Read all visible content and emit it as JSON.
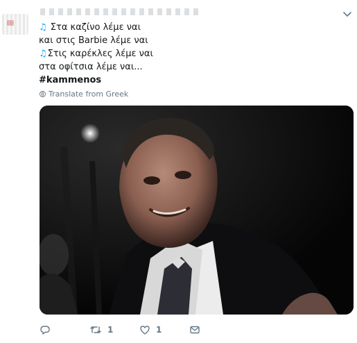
{
  "tweet": {
    "lines": [
      {
        "note_icon": "musical-notes-emoji",
        "text": "Στα καζίνο λέμε ναι"
      },
      {
        "text": "και στις Barbie λέμε ναι"
      },
      {
        "note_icon": "musical-notes-emoji",
        "text": "Στις καρέκλες λέμε ναι"
      },
      {
        "text": "στα οφίτσια λέμε ναι..."
      }
    ],
    "hashtag": "#kammenos",
    "translate_label": "Translate from Greek",
    "media_icon": "photo-man-in-suit-smiling"
  },
  "actions": {
    "reply": {
      "icon": "reply-icon"
    },
    "retweet": {
      "icon": "retweet-icon",
      "count": "1"
    },
    "like": {
      "icon": "heart-icon",
      "count": "1"
    },
    "message": {
      "icon": "envelope-icon"
    }
  },
  "colors": {
    "accent": "#1da1f2",
    "secondary_text": "#657786",
    "primary_text": "#14171a"
  }
}
